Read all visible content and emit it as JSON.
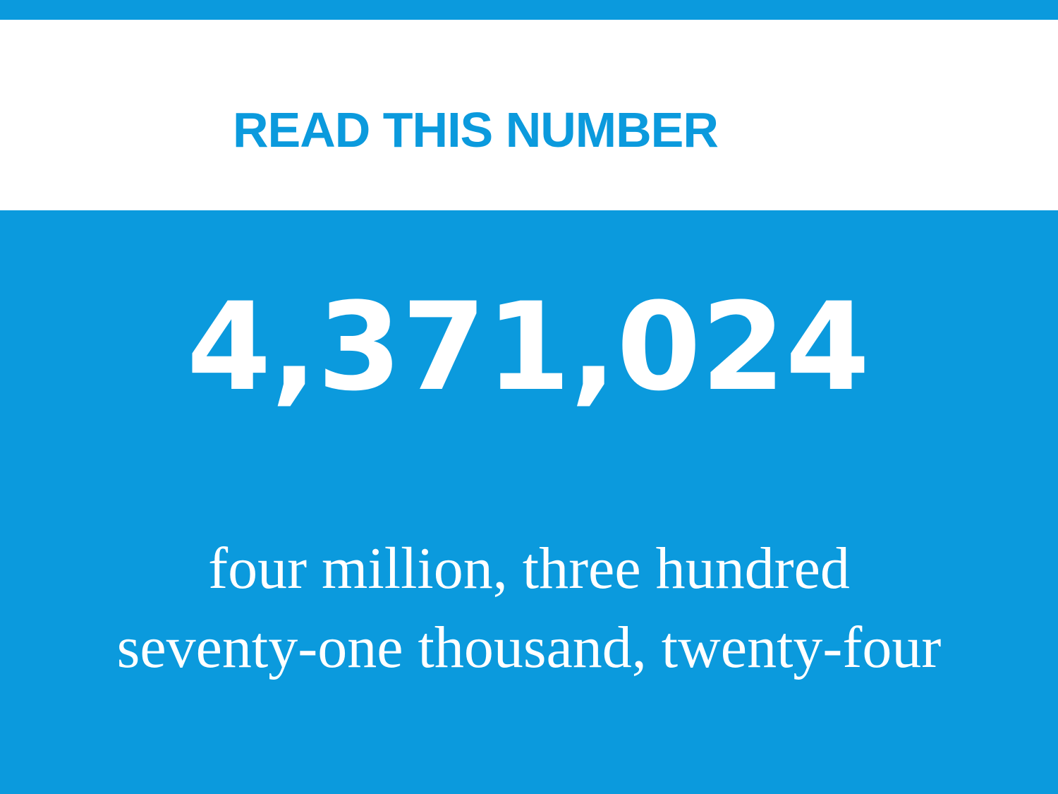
{
  "slide": {
    "title": "READ THIS NUMBER",
    "number": "4,371,024",
    "words_line_1": "four million, three hundred",
    "words_line_2": "seventy-one thousand, twenty-four"
  },
  "colors": {
    "accent": "#0b9add",
    "background": "#ffffff",
    "content_text": "#ffffff"
  }
}
